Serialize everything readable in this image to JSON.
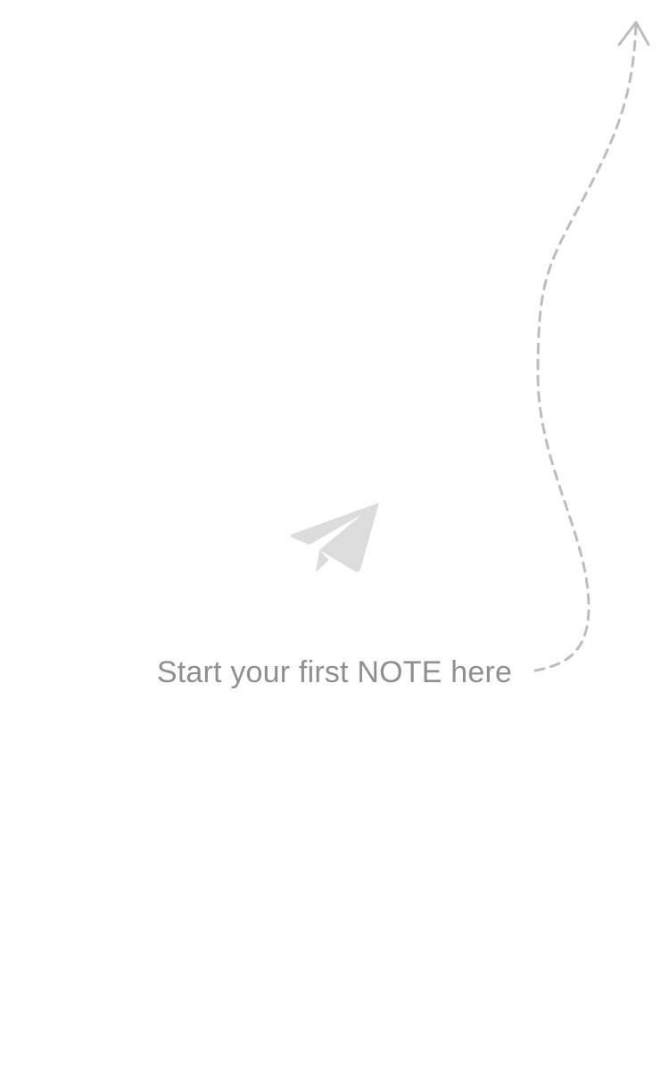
{
  "empty_state": {
    "message": "Start your first NOTE here",
    "icon": "paper-plane-icon",
    "pointer_icon": "dashed-arrow-up-icon"
  },
  "colors": {
    "background": "#ffffff",
    "message_text": "#8f8f8f",
    "icon_fill": "#dcdcdc",
    "arrow_stroke": "#bdbdbd"
  }
}
